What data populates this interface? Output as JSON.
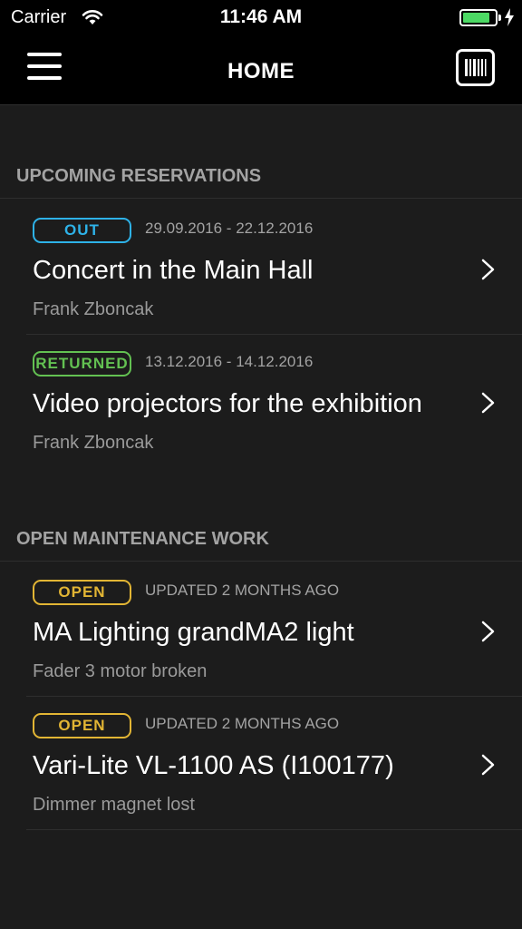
{
  "status_bar": {
    "carrier": "Carrier",
    "time": "11:46 AM",
    "battery_level": 0.85,
    "battery_color": "#4cd964"
  },
  "nav": {
    "title": "HOME",
    "menu_icon": "hamburger-icon",
    "scan_icon": "barcode-icon"
  },
  "sections": {
    "reservations": {
      "title": "UPCOMING RESERVATIONS",
      "items": [
        {
          "status": "OUT",
          "dates": "29.09.2016 - 22.12.2016",
          "title": "Concert in the Main Hall",
          "subtitle": "Frank Zboncak"
        },
        {
          "status": "RETURNED",
          "dates": "13.12.2016 - 14.12.2016",
          "title": "Video projectors for the exhibition",
          "subtitle": "Frank Zboncak"
        }
      ]
    },
    "maintenance": {
      "title": "OPEN MAINTENANCE WORK",
      "items": [
        {
          "status": "OPEN",
          "updated": "UPDATED 2 MONTHS AGO",
          "title": "MA Lighting grandMA2 light",
          "subtitle": "Fader 3 motor broken"
        },
        {
          "status": "OPEN",
          "updated": "UPDATED 2 MONTHS AGO",
          "title": "Vari-Lite VL-1100 AS (I100177)",
          "subtitle": "Dimmer magnet lost"
        }
      ]
    }
  },
  "colors": {
    "out": "#2eb2e8",
    "returned": "#63c152",
    "open": "#e2b534"
  }
}
